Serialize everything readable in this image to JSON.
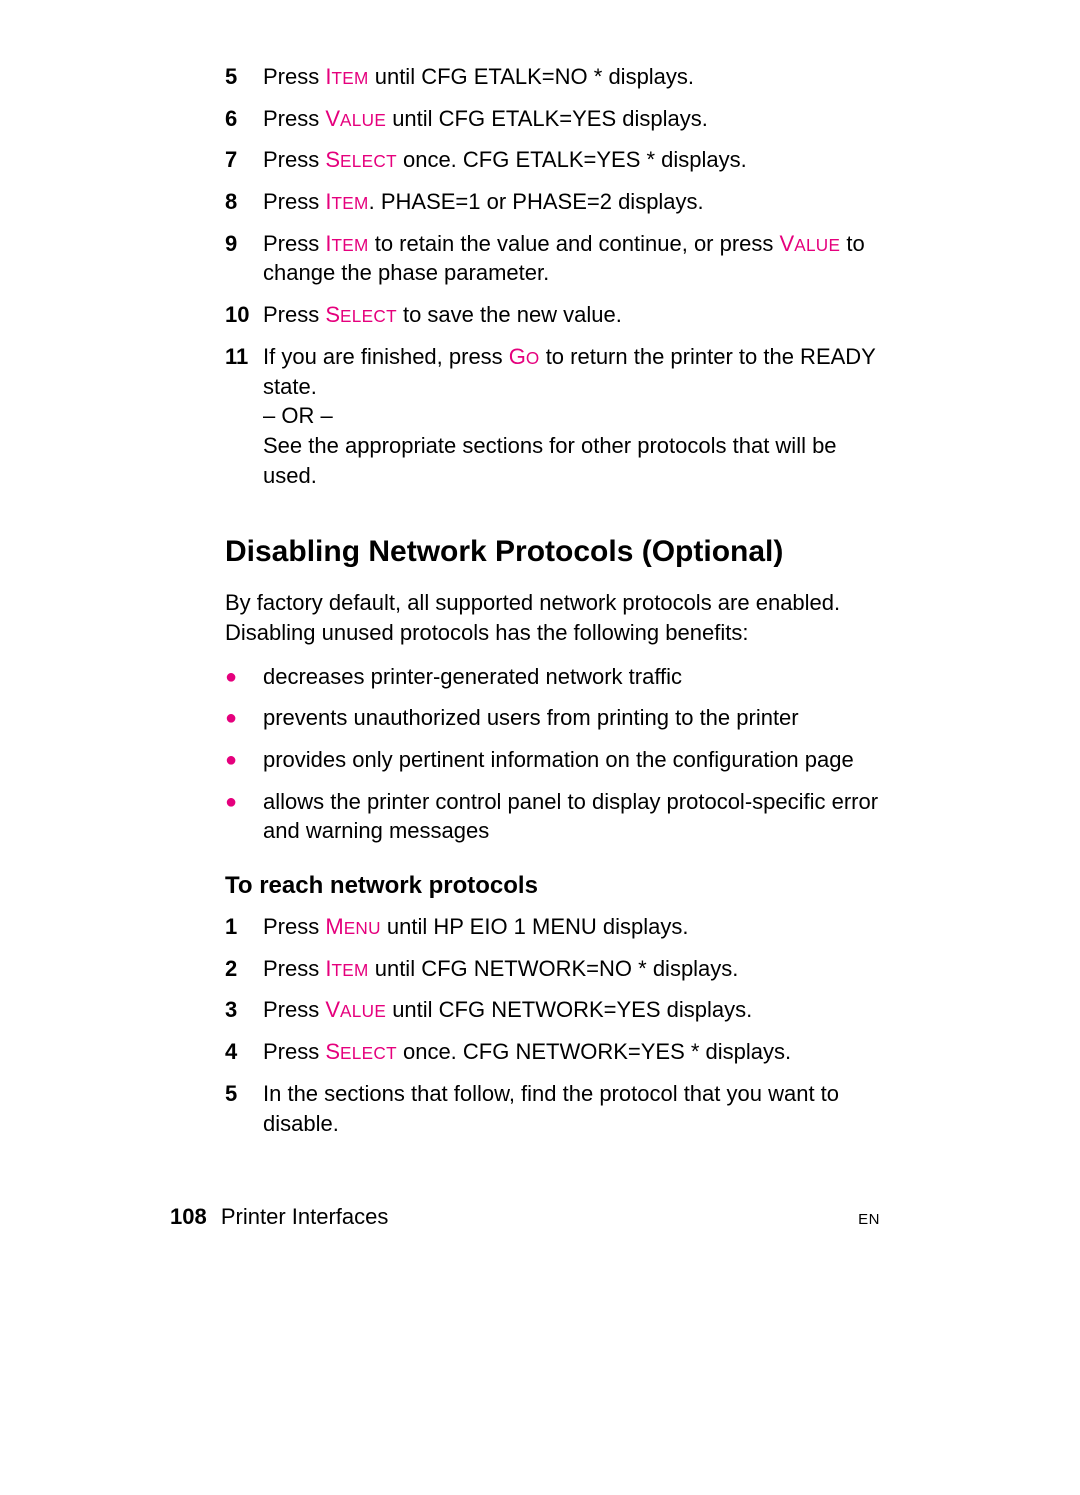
{
  "accent_color": "#e5007d",
  "list1": {
    "start": 5,
    "items": [
      {
        "num": "5",
        "pre": "Press ",
        "btn_first": "I",
        "btn_rest": "TEM",
        "post": " until CFG ETALK=NO * displays."
      },
      {
        "num": "6",
        "pre": "Press ",
        "btn_first": "V",
        "btn_rest": "ALUE",
        "post": " until CFG ETALK=YES displays."
      },
      {
        "num": "7",
        "pre": "Press ",
        "btn_first": "S",
        "btn_rest": "ELECT",
        "post": " once. CFG ETALK=YES * displays."
      },
      {
        "num": "8",
        "pre": "Press ",
        "btn_first": "I",
        "btn_rest": "TEM",
        "post": ". PHASE=1 or PHASE=2 displays."
      },
      {
        "num": "9",
        "pre": "Press ",
        "btn_first": "I",
        "btn_rest": "TEM",
        "post": " to retain the value and continue, or press ",
        "btn2_first": "V",
        "btn2_rest": "ALUE",
        "post2": " to change the phase parameter."
      },
      {
        "num": "10",
        "pre": "Press ",
        "btn_first": "S",
        "btn_rest": "ELECT",
        "post": " to save the new value."
      },
      {
        "num": "11",
        "pre": "If you are finished, press ",
        "btn_first": "G",
        "btn_rest": "O",
        "post": " to return the printer to the READY state.",
        "line2": "– OR –",
        "line3": "See the appropriate sections for other protocols that will be used."
      }
    ]
  },
  "section_heading": "Disabling Network Protocols (Optional)",
  "intro_para": "By factory default, all supported network protocols are enabled. Disabling unused protocols has the following benefits:",
  "bullets": [
    "decreases printer-generated network traffic",
    "prevents unauthorized users from printing to the printer",
    "provides only pertinent information on the configuration page",
    "allows the printer control panel to display protocol-specific error and warning messages"
  ],
  "subsection_heading": "To reach network protocols",
  "list2": {
    "start": 1,
    "items": [
      {
        "num": "1",
        "pre": "Press ",
        "btn_first": "M",
        "btn_rest": "ENU",
        "post": " until HP EIO 1 MENU displays."
      },
      {
        "num": "2",
        "pre": "Press ",
        "btn_first": "I",
        "btn_rest": "TEM",
        "post": " until CFG NETWORK=NO * displays."
      },
      {
        "num": "3",
        "pre": "Press ",
        "btn_first": "V",
        "btn_rest": "ALUE",
        "post": " until CFG NETWORK=YES displays."
      },
      {
        "num": "4",
        "pre": "Press ",
        "btn_first": "S",
        "btn_rest": "ELECT",
        "post": " once. CFG NETWORK=YES * displays."
      },
      {
        "num": "5",
        "pre": "In the sections that follow, find the protocol that you want to disable."
      }
    ]
  },
  "footer": {
    "page_number": "108",
    "chapter": "Printer Interfaces",
    "lang": "EN"
  }
}
